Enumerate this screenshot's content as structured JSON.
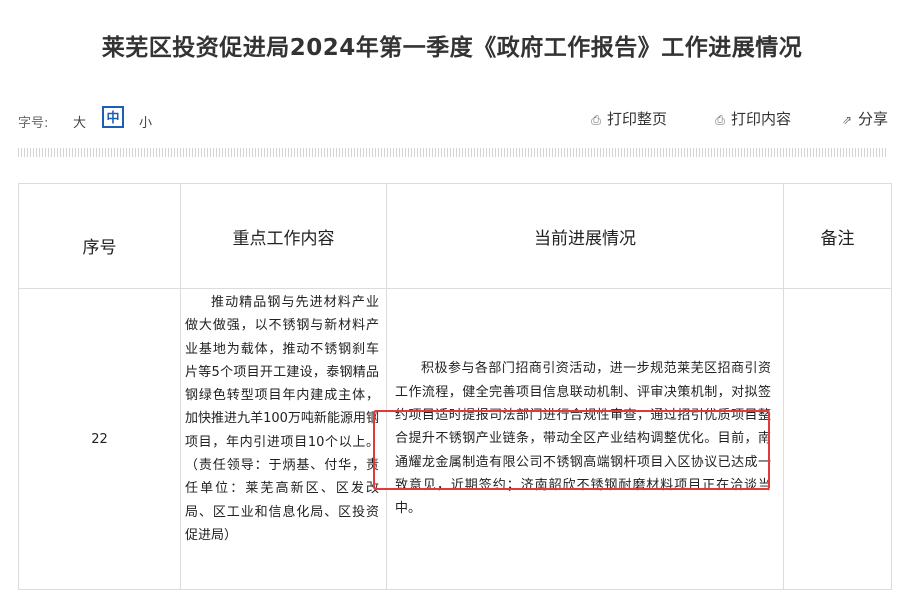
{
  "page": {
    "title": "莱芜区投资促进局2024年第一季度《政府工作报告》工作进展情况"
  },
  "toolbar": {
    "font_size_label": "字号:",
    "size_large": "大",
    "size_medium": "中",
    "size_small": "小",
    "print_page": "打印整页",
    "print_content": "打印内容",
    "share": "分享"
  },
  "table": {
    "headers": [
      "序号",
      "重点工作内容",
      "当前进展情况",
      "备注"
    ],
    "rows": [
      {
        "seq": "22",
        "work": "推动精品钢与先进材料产业做大做强，以不锈钢与新材料产业基地为载体，推动不锈钢刹车片等5个项目开工建设，泰钢精品钢绿色转型项目年内建成主体，加快推进九羊100万吨新能源用钢项目，年内引进项目10个以上。（责任领导：于炳基、付华，责任单位：莱芜高新区、区发改局、区工业和信息化局、区投资促进局）",
        "progress": "积极参与各部门招商引资活动，进一步规范莱芜区招商引资工作流程，健全完善项目信息联动机制、评审决策机制，对拟签约项目适时提报司法部门进行合规性审查，通过招引优质项目整合提升不锈钢产业链条，带动全区产业结构调整优化。目前，南通耀龙金属制造有限公司不锈钢高端钢杆项目入区协议已达成一致意见，近期签约；济南韶欣不锈钢耐磨材料项目正在洽谈当中。",
        "remark": ""
      }
    ]
  },
  "colors": {
    "accent": "#1a5fb4",
    "highlight_border": "#e23a3a"
  },
  "icons": {
    "print_page": "printer-icon",
    "print_content": "printer-icon",
    "share": "share-icon"
  }
}
